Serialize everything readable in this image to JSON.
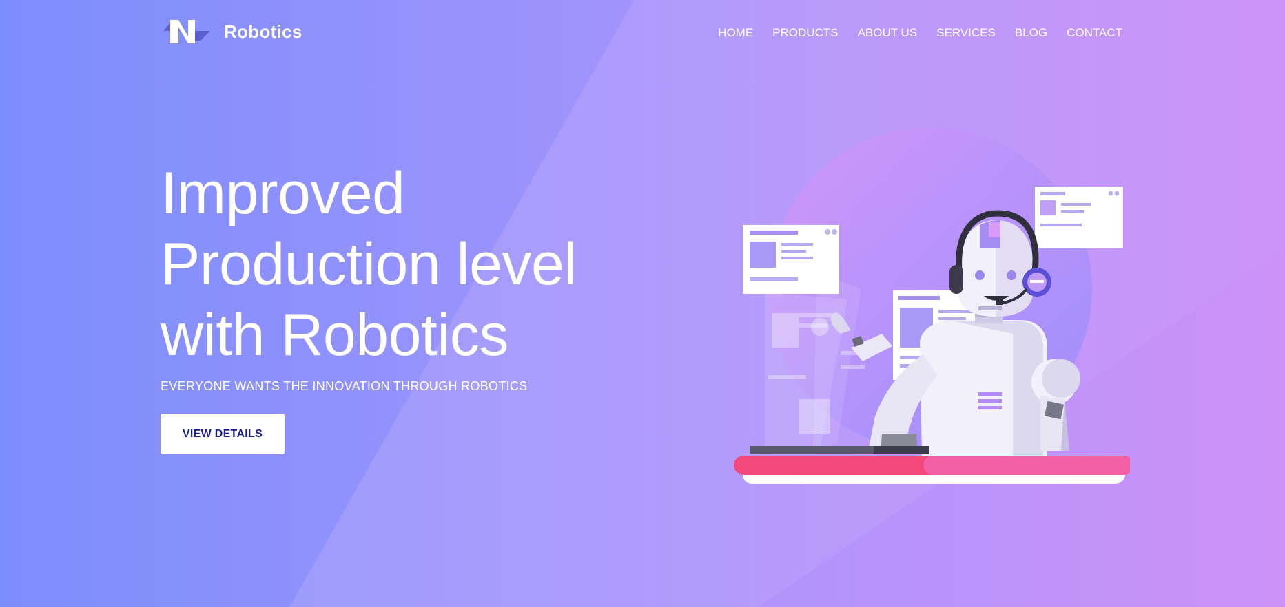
{
  "brand": {
    "name": "Robotics",
    "logo_icon": "robotics-logo-icon"
  },
  "nav": {
    "items": [
      {
        "label": "HOME"
      },
      {
        "label": "PRODUCTS"
      },
      {
        "label": "ABOUT US"
      },
      {
        "label": "SERVICES"
      },
      {
        "label": "BLOG"
      },
      {
        "label": "CONTACT"
      }
    ]
  },
  "hero": {
    "title_lines": [
      "Improved",
      "Production level",
      "with Robotics"
    ],
    "subtitle": "EVERYONE WANTS THE INNOVATION THROUGH ROBOTICS",
    "cta_label": "VIEW DETAILS"
  },
  "colors": {
    "gradient_start": "#7e8ffc",
    "gradient_end": "#cc92f8",
    "button_text": "#1d1d8a",
    "desk_accent": "#f4477a"
  },
  "illustration": {
    "icon": "robot-with-headset-illustration"
  }
}
